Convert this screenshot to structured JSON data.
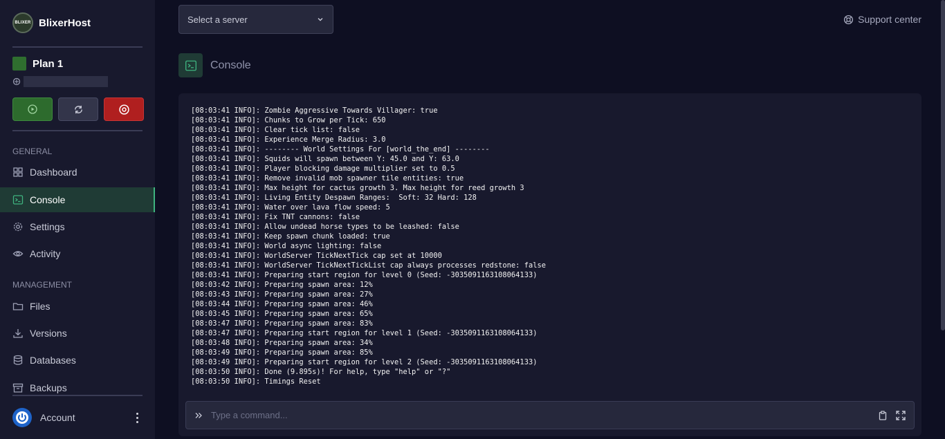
{
  "brand": {
    "name": "BlixerHost",
    "logo_text": "BLIXER"
  },
  "plan": {
    "name": "Plan 1"
  },
  "sections": {
    "general": "GENERAL",
    "management": "MANAGEMENT"
  },
  "nav": {
    "dashboard": "Dashboard",
    "console": "Console",
    "settings": "Settings",
    "activity": "Activity",
    "files": "Files",
    "versions": "Versions",
    "databases": "Databases",
    "backups": "Backups"
  },
  "account": {
    "label": "Account"
  },
  "header": {
    "server_select": "Select a server",
    "support": "Support center"
  },
  "page": {
    "title": "Console"
  },
  "console": {
    "lines": [
      "[08:03:41 INFO]: Zombie Aggressive Towards Villager: true",
      "[08:03:41 INFO]: Chunks to Grow per Tick: 650",
      "[08:03:41 INFO]: Clear tick list: false",
      "[08:03:41 INFO]: Experience Merge Radius: 3.0",
      "[08:03:41 INFO]: -------- World Settings For [world_the_end] --------",
      "[08:03:41 INFO]: Squids will spawn between Y: 45.0 and Y: 63.0",
      "[08:03:41 INFO]: Player blocking damage multiplier set to 0.5",
      "[08:03:41 INFO]: Remove invalid mob spawner tile entities: true",
      "[08:03:41 INFO]: Max height for cactus growth 3. Max height for reed growth 3",
      "[08:03:41 INFO]: Living Entity Despawn Ranges:  Soft: 32 Hard: 128",
      "[08:03:41 INFO]: Water over lava flow speed: 5",
      "[08:03:41 INFO]: Fix TNT cannons: false",
      "[08:03:41 INFO]: Allow undead horse types to be leashed: false",
      "[08:03:41 INFO]: Keep spawn chunk loaded: true",
      "[08:03:41 INFO]: World async lighting: false",
      "[08:03:41 INFO]: WorldServer TickNextTick cap set at 10000",
      "[08:03:41 INFO]: WorldServer TickNextTickList cap always processes redstone: false",
      "[08:03:41 INFO]: Preparing start region for level 0 (Seed: -3035091163108064133)",
      "[08:03:42 INFO]: Preparing spawn area: 12%",
      "[08:03:43 INFO]: Preparing spawn area: 27%",
      "[08:03:44 INFO]: Preparing spawn area: 46%",
      "[08:03:45 INFO]: Preparing spawn area: 65%",
      "[08:03:47 INFO]: Preparing spawn area: 83%",
      "[08:03:47 INFO]: Preparing start region for level 1 (Seed: -3035091163108064133)",
      "[08:03:48 INFO]: Preparing spawn area: 34%",
      "[08:03:49 INFO]: Preparing spawn area: 85%",
      "[08:03:49 INFO]: Preparing start region for level 2 (Seed: -3035091163108064133)",
      "[08:03:50 INFO]: Done (9.895s)! For help, type \"help\" or \"?\"",
      "[08:03:50 INFO]: Timings Reset"
    ],
    "command_placeholder": "Type a command..."
  },
  "colors": {
    "background": "#0e0f22",
    "sidebar": "#18192d",
    "accent": "#3fb37f",
    "start": "#2d6b2d",
    "stop": "#b01f1f"
  }
}
